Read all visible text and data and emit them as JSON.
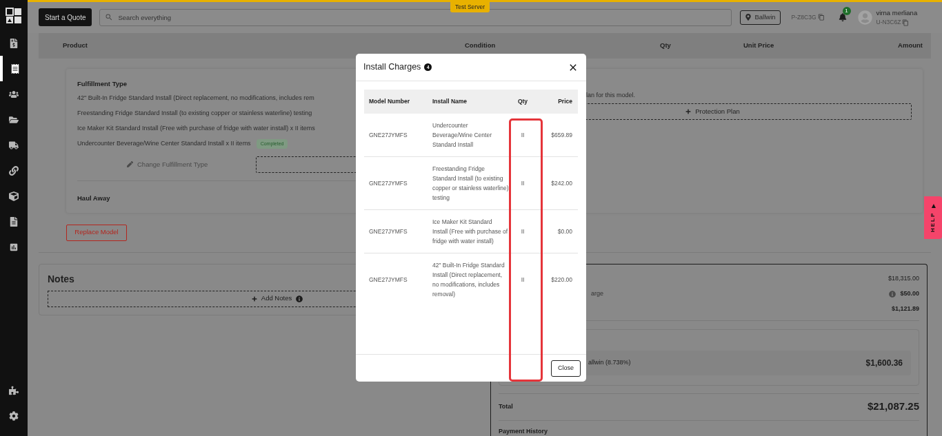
{
  "sidebar": {
    "items": [
      {
        "selected": false
      },
      {
        "selected": true
      },
      {
        "selected": false
      },
      {
        "selected": false
      },
      {
        "selected": false
      },
      {
        "selected": false
      },
      {
        "selected": false
      },
      {
        "selected": false
      },
      {
        "selected": false
      }
    ],
    "bottom_items": [
      {
        "selected": false
      },
      {
        "selected": false
      }
    ]
  },
  "top_bar": {
    "start_button": "Start a Quote",
    "search": {
      "placeholder": "Search everything"
    },
    "environment_badge": "Test Server",
    "location": "Ballwin",
    "project_id": "P-Z8C3G",
    "notification_count": "1",
    "user": {
      "name": "virna merliana",
      "id": "U-N3C6Z"
    }
  },
  "table_header": {
    "columns": [
      "Product",
      "Condition",
      "Qty",
      "Unit Price",
      "Amount"
    ]
  },
  "fulfillment": {
    "title": "Fulfillment Type",
    "lines": [
      {
        "text": "42\" Built-In Fridge Standard Install (Direct replacement, no modifications, includes rem"
      },
      {
        "text": "Freestanding Fridge Standard Install (to existing copper or stainless waterline) testing"
      },
      {
        "text": "Ice Maker Kit Standard Install (Free with purchase of fridge with water install) x II items"
      },
      {
        "text": "Undercounter Beverage/Wine Center Standard Install x II items",
        "badge": "Completed"
      }
    ],
    "change_button": {
      "label": "Change Fulfillment Type",
      "disabled": true
    },
    "haul_away": "Haul Away",
    "protection_note": "lan for this model.",
    "protection_button": "Protection Plan"
  },
  "replace_button": "Replace Model",
  "notes": {
    "title": "Notes",
    "add_button": "Add Notes"
  },
  "summary": {
    "rows": [
      {
        "label": "",
        "value": "$18,315.00",
        "bold": false,
        "info": false
      },
      {
        "label": "arge",
        "value": "$50.00",
        "bold": true,
        "info": true
      },
      {
        "label": "",
        "value": "$1,121.89",
        "bold": true,
        "info": false
      }
    ],
    "tax": {
      "label": "allwin (8.738%)",
      "value": "$1,600.36"
    },
    "total_label": "Total",
    "total_value": "$21,087.25",
    "payment_history": "Payment History"
  },
  "modal": {
    "title": "Install Charges",
    "count": "4",
    "columns": [
      "Model Number",
      "Install Name",
      "Qty",
      "Price"
    ],
    "rows": [
      {
        "model": "GNE27JYMFS",
        "name": "Undercounter Beverage/Wine Center Standard Install",
        "qty": "II",
        "price": "$659.89"
      },
      {
        "model": "GNE27JYMFS",
        "name": "Freestanding Fridge Standard Install (to existing copper or stainless waterline) testing",
        "qty": "II",
        "price": "$242.00"
      },
      {
        "model": "GNE27JYMFS",
        "name": "Ice Maker Kit Standard Install (Free with purchase of fridge with water install)",
        "qty": "II",
        "price": "$0.00"
      },
      {
        "model": "GNE27JYMFS",
        "name": "42\" Built-In Fridge Standard Install (Direct replacement, no modifications, includes removal)",
        "qty": "II",
        "price": "$220.00"
      }
    ],
    "close_button": "Close"
  },
  "help_tab": "HELP",
  "help_arrow": "▶"
}
